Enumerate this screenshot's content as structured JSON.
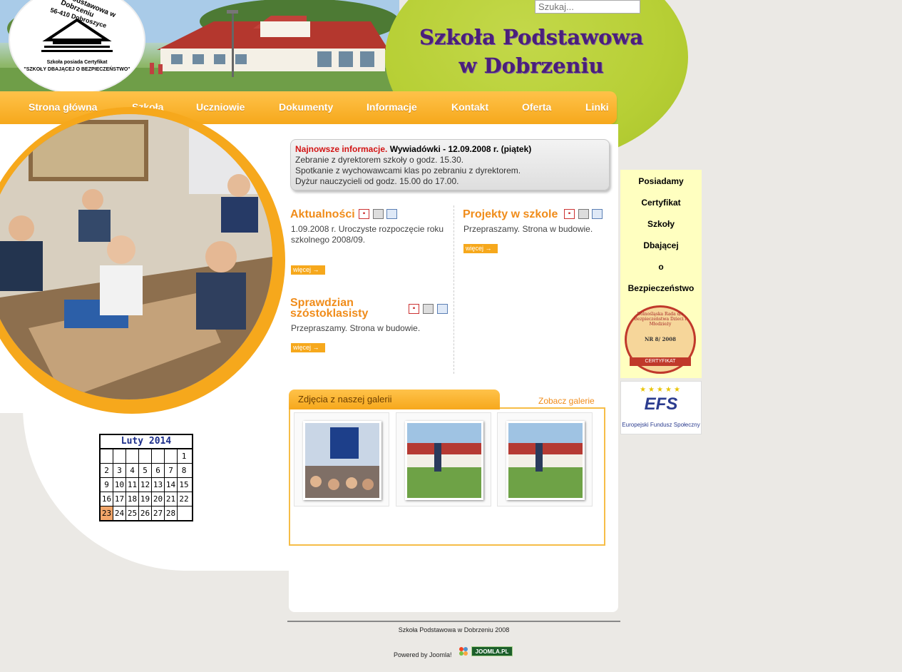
{
  "header": {
    "title_line1": "Szkoła Podstawowa",
    "title_line2": "w Dobrzeniu",
    "search_placeholder": "Szukaj...",
    "logo": {
      "line1": "Szkoła Podstawowa w Dobrzeniu",
      "line2": "56-410 Dobroszyce",
      "line3": "Szkoła posiada Certyfikat",
      "line4": "\"SZKOŁY DBAJĄCEJ O BEZPIECZEŃSTWO\""
    }
  },
  "nav": {
    "items": [
      "Strona główna",
      "Szkoła",
      "Uczniowie",
      "Dokumenty",
      "Informacje",
      "Kontakt",
      "Oferta",
      "Linki"
    ]
  },
  "news": {
    "label": "Najnowsze informacje.",
    "headline": "Wywiadówki - 12.09.2008 r. (piątek)",
    "lines": [
      "Zebranie z dyrektorem szkoły o godz. 15.30.",
      "Spotkanie z wychowawcami klas po zebraniu z dyrektorem.",
      "Dyżur nauczycieli od godz. 15.00 do 17.00."
    ]
  },
  "sections": {
    "aktualnosci": {
      "title": "Aktualności",
      "body": "1.09.2008 r. Uroczyste rozpoczęcie roku szkolnego 2008/09.",
      "more": "więcej"
    },
    "projekty": {
      "title": "Projekty w szkole",
      "body": "Przepraszamy. Strona w budowie.",
      "more": "więcej"
    },
    "sprawdzian": {
      "title_line1": "Sprawdzian",
      "title_line2": "szóstoklasisty",
      "body": "Przepraszamy. Strona w budowie.",
      "more": "więcej"
    }
  },
  "gallery": {
    "tab_label": "Zdjęcia z naszej galerii",
    "link_label": "Zobacz galerie"
  },
  "calendar": {
    "title": "Luty 2014",
    "weeks": [
      [
        "",
        "",
        "",
        "",
        "",
        "",
        "1"
      ],
      [
        "2",
        "3",
        "4",
        "5",
        "6",
        "7",
        "8"
      ],
      [
        "9",
        "10",
        "11",
        "12",
        "13",
        "14",
        "15"
      ],
      [
        "16",
        "17",
        "18",
        "19",
        "20",
        "21",
        "22"
      ],
      [
        "23",
        "24",
        "25",
        "26",
        "27",
        "28",
        ""
      ]
    ],
    "today": "23"
  },
  "sidebar": {
    "cert_lines": [
      "Posiadamy",
      "Certyfikat",
      "Szkoły",
      "Dbającej",
      "o",
      "Bezpieczeństwo"
    ],
    "seal_text": "Dolnośląska Rada d/s Bezpieczeństwa Dzieci i Młodzieży",
    "seal_number": "NR 8/ 2008",
    "seal_ribbon": "CERTYFIKAT",
    "efs_logo": "EFS",
    "efs_caption": "Europejski Fundusz Społeczny"
  },
  "footer": {
    "copyright": "Szkoła Podstawowa w Dobrzeniu 2008",
    "powered": "Powered by Joomla!",
    "badge": "JOOMLA.PL"
  }
}
